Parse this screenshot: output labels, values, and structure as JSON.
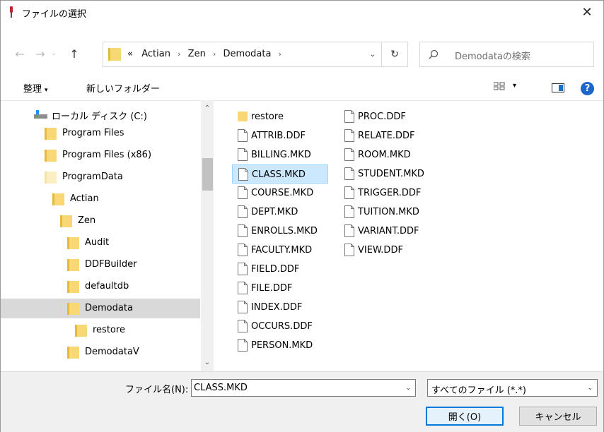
{
  "window": {
    "title": "ファイルの選択",
    "close_glyph": "✕"
  },
  "nav": {
    "back_glyph": "←",
    "forward_glyph": "→",
    "recent_glyph": "⌄",
    "up_glyph": "↑",
    "breadcrumb_overflow": "«",
    "breadcrumbs": [
      "Actian",
      "Zen",
      "Demodata"
    ],
    "separator": "›",
    "dropdown_glyph": "⌄",
    "refresh_glyph": "↻",
    "search_placeholder": "Demodataの検索"
  },
  "toolbar": {
    "organize_label": "整理",
    "organize_caret": "▾",
    "new_folder_label": "新しいフォルダー",
    "view_caret": "▾",
    "help_label": "?"
  },
  "tree": {
    "drive_label": "ローカル ディスク (C:)",
    "items": [
      {
        "label": "Program Files",
        "level": 1,
        "selected": false
      },
      {
        "label": "Program Files (x86)",
        "level": 1,
        "selected": false
      },
      {
        "label": "ProgramData",
        "level": 1,
        "selected": false,
        "faded": true
      },
      {
        "label": "Actian",
        "level": 2,
        "selected": false
      },
      {
        "label": "Zen",
        "level": 3,
        "selected": false
      },
      {
        "label": "Audit",
        "level": 4,
        "selected": false
      },
      {
        "label": "DDFBuilder",
        "level": 4,
        "selected": false
      },
      {
        "label": "defaultdb",
        "level": 4,
        "selected": false
      },
      {
        "label": "Demodata",
        "level": 4,
        "selected": true
      },
      {
        "label": "restore",
        "level": 5,
        "selected": false
      },
      {
        "label": "DemodataV",
        "level": 4,
        "selected": false
      }
    ],
    "scroll_up_glyph": "⌃",
    "scroll_down_glyph": "⌄"
  },
  "files": {
    "column1": [
      {
        "name": "restore",
        "type": "folder"
      },
      {
        "name": "ATTRIB.DDF",
        "type": "file"
      },
      {
        "name": "BILLING.MKD",
        "type": "file"
      },
      {
        "name": "CLASS.MKD",
        "type": "file",
        "selected": true
      },
      {
        "name": "COURSE.MKD",
        "type": "file"
      },
      {
        "name": "DEPT.MKD",
        "type": "file"
      },
      {
        "name": "ENROLLS.MKD",
        "type": "file"
      },
      {
        "name": "FACULTY.MKD",
        "type": "file"
      },
      {
        "name": "FIELD.DDF",
        "type": "file"
      },
      {
        "name": "FILE.DDF",
        "type": "file"
      },
      {
        "name": "INDEX.DDF",
        "type": "file"
      },
      {
        "name": "OCCURS.DDF",
        "type": "file"
      },
      {
        "name": "PERSON.MKD",
        "type": "file"
      }
    ],
    "column2": [
      {
        "name": "PROC.DDF",
        "type": "file"
      },
      {
        "name": "RELATE.DDF",
        "type": "file"
      },
      {
        "name": "ROOM.MKD",
        "type": "file"
      },
      {
        "name": "STUDENT.MKD",
        "type": "file"
      },
      {
        "name": "TRIGGER.DDF",
        "type": "file"
      },
      {
        "name": "TUITION.MKD",
        "type": "file"
      },
      {
        "name": "VARIANT.DDF",
        "type": "file"
      },
      {
        "name": "VIEW.DDF",
        "type": "file"
      }
    ]
  },
  "bottom": {
    "filename_label": "ファイル名(N):",
    "filename_value": "CLASS.MKD",
    "filetype_value": "すべてのファイル (*.*)",
    "dropdown_glyph": "⌄",
    "open_label": "開く(O)",
    "cancel_label": "キャンセル"
  },
  "colors": {
    "accent": "#0078d7",
    "folder": "#f8d775",
    "selection": "#cce8ff",
    "tree_selection": "#d9d9d9"
  }
}
